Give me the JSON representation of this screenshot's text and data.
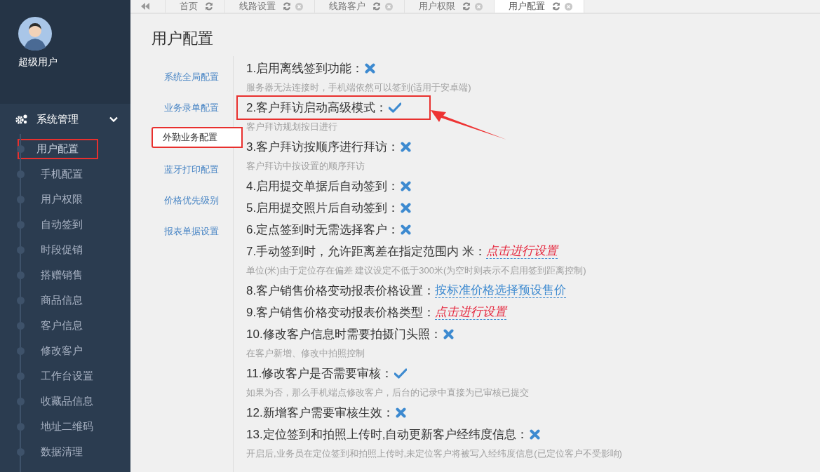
{
  "sidebar": {
    "user_name": "超级用户",
    "menu": {
      "label": "系统管理",
      "expanded": true,
      "items": [
        {
          "label": "用户配置",
          "selected": true,
          "annotated": true
        },
        {
          "label": "手机配置",
          "selected": false,
          "annotated": false
        },
        {
          "label": "用户权限",
          "selected": false,
          "annotated": false
        },
        {
          "label": "自动签到",
          "selected": false,
          "annotated": false
        },
        {
          "label": "时段促销",
          "selected": false,
          "annotated": false
        },
        {
          "label": "搭赠销售",
          "selected": false,
          "annotated": false
        },
        {
          "label": "商品信息",
          "selected": false,
          "annotated": false
        },
        {
          "label": "客户信息",
          "selected": false,
          "annotated": false
        },
        {
          "label": "修改客户",
          "selected": false,
          "annotated": false
        },
        {
          "label": "工作台设置",
          "selected": false,
          "annotated": false
        },
        {
          "label": "收藏品信息",
          "selected": false,
          "annotated": false
        },
        {
          "label": "地址二维码",
          "selected": false,
          "annotated": false
        },
        {
          "label": "数据清理",
          "selected": false,
          "annotated": false
        }
      ]
    }
  },
  "tabs": [
    {
      "label": "首页",
      "selected": false,
      "closable": false
    },
    {
      "label": "线路设置",
      "selected": false,
      "closable": true
    },
    {
      "label": "线路客户",
      "selected": false,
      "closable": true
    },
    {
      "label": "用户权限",
      "selected": false,
      "closable": true
    },
    {
      "label": "用户配置",
      "selected": true,
      "closable": true
    }
  ],
  "page_title": "用户配置",
  "sub_nav": [
    {
      "label": "系统全局配置",
      "selected": false,
      "annotated": false
    },
    {
      "label": "业务录单配置",
      "selected": false,
      "annotated": false
    },
    {
      "label": "外勤业务配置",
      "selected": true,
      "annotated": true
    },
    {
      "label": "蓝牙打印配置",
      "selected": false,
      "annotated": false
    },
    {
      "label": "价格优先级别",
      "selected": false,
      "annotated": false
    },
    {
      "label": "报表单据设置",
      "selected": false,
      "annotated": false
    }
  ],
  "settings": [
    {
      "kind": "toggle",
      "label": "1.启用离线签到功能：",
      "on": false,
      "annotated": false,
      "hint": "服务器无法连接时，手机端依然可以签到(适用于安卓端)"
    },
    {
      "kind": "toggle",
      "label": "2.客户拜访启动高级模式：",
      "on": true,
      "annotated": true,
      "hint": "客户拜访规划按日进行"
    },
    {
      "kind": "toggle",
      "label": "3.客户拜访按顺序进行拜访：",
      "on": false,
      "annotated": false,
      "hint": "客户拜访中按设置的顺序拜访"
    },
    {
      "kind": "toggle",
      "label": "4.启用提交单据后自动签到：",
      "on": false,
      "annotated": false
    },
    {
      "kind": "toggle",
      "label": "5.启用提交照片后自动签到：",
      "on": false,
      "annotated": false
    },
    {
      "kind": "toggle",
      "label": "6.定点签到时无需选择客户：",
      "on": false,
      "annotated": false
    },
    {
      "kind": "link",
      "label": "7.手动签到时，允许距离差在指定范围内 米：",
      "value": "点击进行设置",
      "set": false,
      "annotated": false,
      "hint": "单位(米)由于定位存在偏差 建议设定不低于300米(为空时则表示不启用签到距离控制)"
    },
    {
      "kind": "link",
      "label": "8.客户销售价格变动报表价格设置：",
      "value": "按标准价格选择预设售价",
      "set": true,
      "annotated": false
    },
    {
      "kind": "link",
      "label": "9.客户销售价格变动报表价格类型：",
      "value": "点击进行设置",
      "set": false,
      "annotated": false
    },
    {
      "kind": "toggle",
      "label": "10.修改客户信息时需要拍摄门头照：",
      "on": false,
      "annotated": false,
      "hint": "在客户新增、修改中拍照控制"
    },
    {
      "kind": "toggle",
      "label": "11.修改客户是否需要审核：",
      "on": true,
      "annotated": false,
      "hint": "如果为否，那么手机端点修改客户，后台的记录中直接为已审核已提交"
    },
    {
      "kind": "toggle",
      "label": "12.新增客户需要审核生效：",
      "on": false,
      "annotated": false
    },
    {
      "kind": "toggle",
      "label": "13.定位签到和拍照上传时,自动更新客户经纬度信息：",
      "on": false,
      "annotated": false,
      "hint": "开启后,业务员在定位签到和拍照上传时,未定位客户将被写入经纬度信息(已定位客户不受影响)"
    }
  ]
}
